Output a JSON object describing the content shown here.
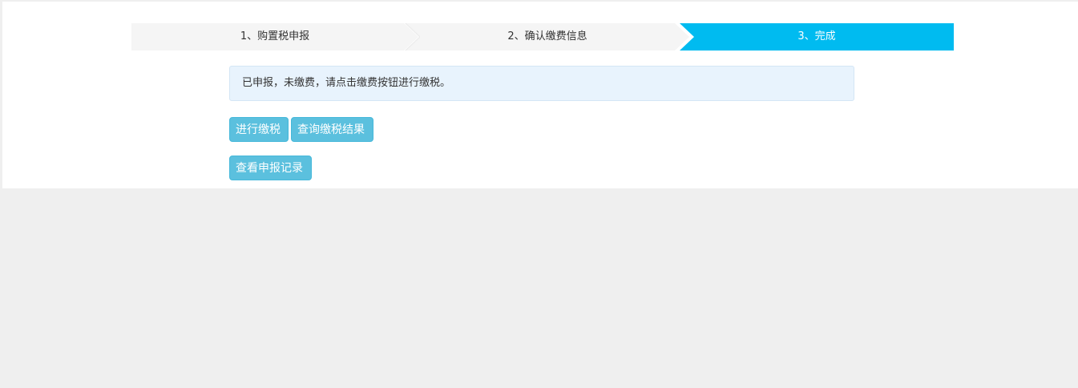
{
  "steps": [
    {
      "label": "1、购置税申报",
      "state": "done"
    },
    {
      "label": "2、确认缴费信息",
      "state": "done"
    },
    {
      "label": "3、完成",
      "state": "active"
    }
  ],
  "alert": {
    "message": "已申报，未缴费，请点击缴费按钮进行缴税。"
  },
  "buttons": {
    "pay": "进行缴税",
    "query_result": "查询缴税结果",
    "view_records": "查看申报记录"
  },
  "colors": {
    "active_step": "#00bbf0",
    "button": "#5bc0de",
    "alert_bg": "#e8f3fd"
  }
}
